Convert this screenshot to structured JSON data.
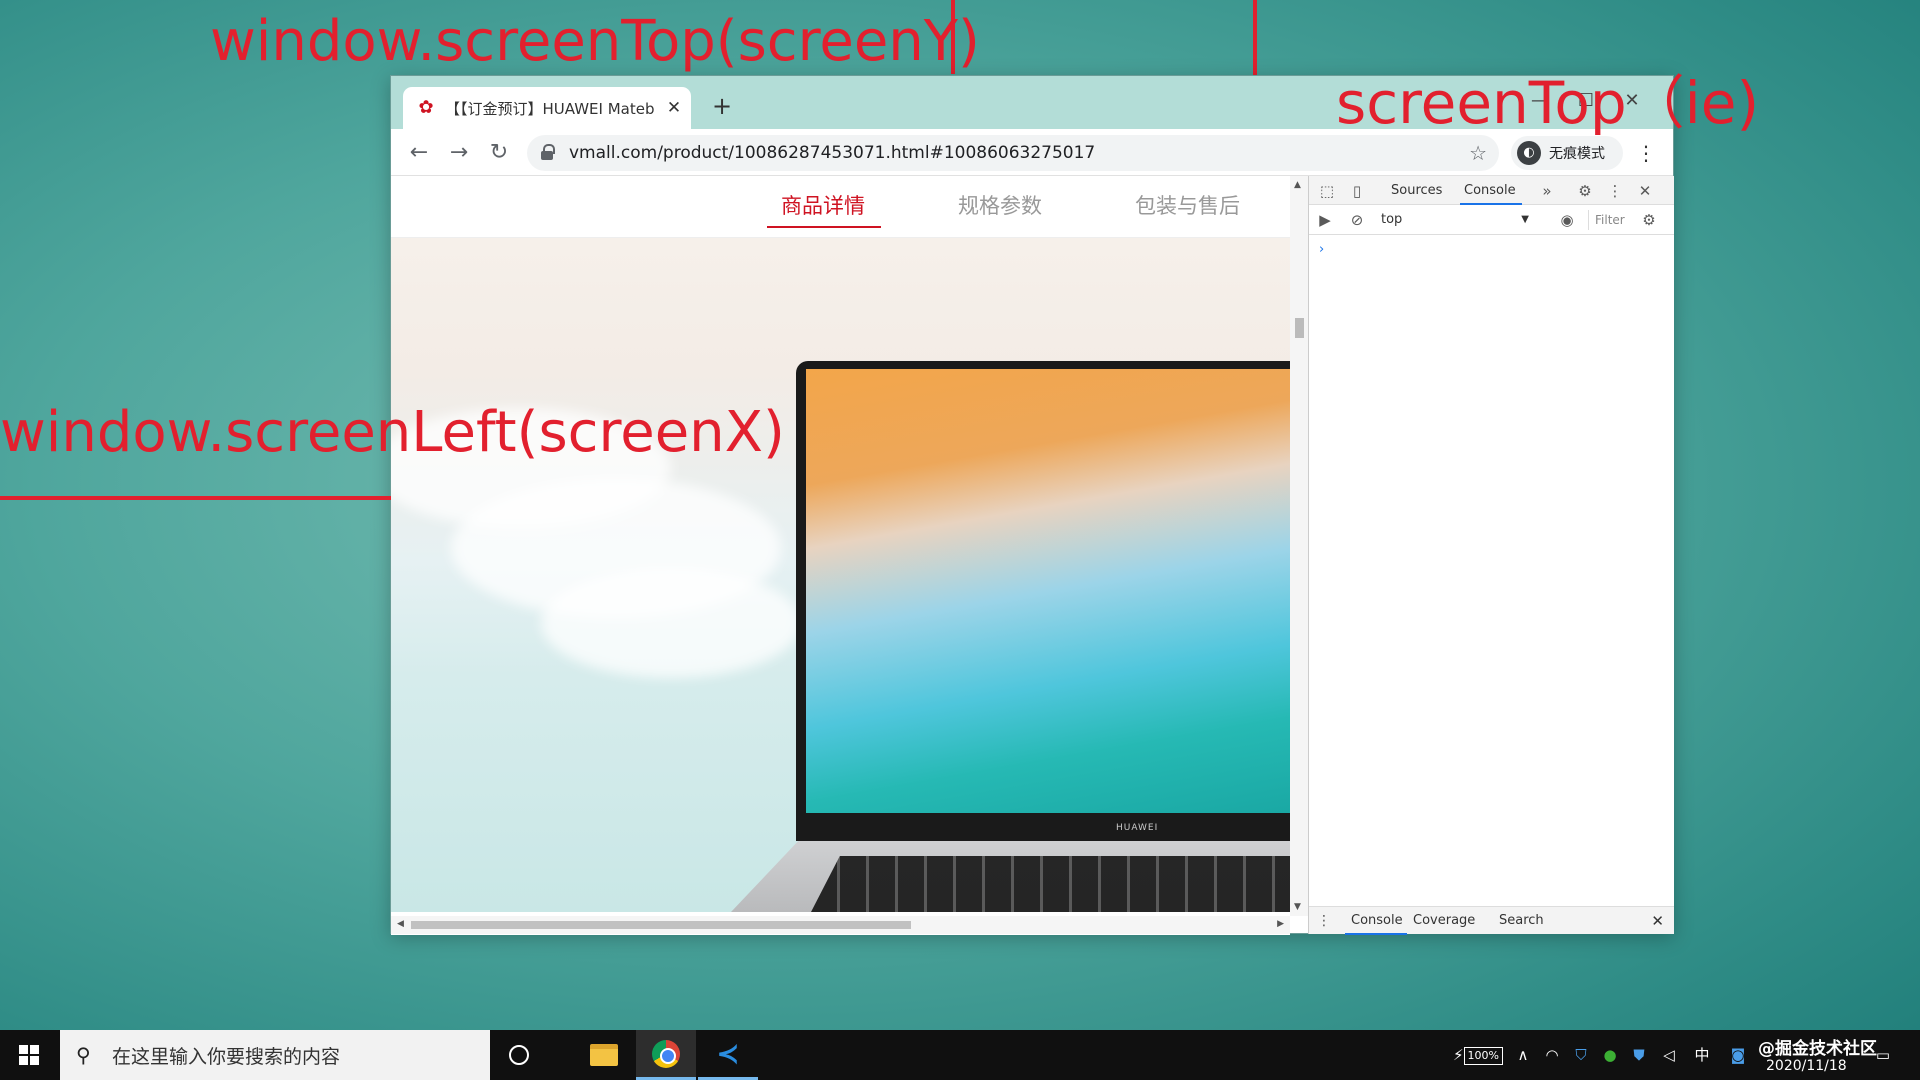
{
  "annotations": {
    "screen_top": "window.screenTop(screenY)",
    "screen_left": "window.screenLeft(screenX)",
    "screen_top_ie": "screenTop（ie)"
  },
  "browser": {
    "tab": {
      "title": "【【订金预订】HUAWEI Mateb",
      "favicon": "huawei-logo"
    },
    "nav": {
      "back_icon": "←",
      "forward_icon": "→",
      "reload_icon": "↻"
    },
    "address_bar": {
      "url": "vmall.com/product/10086287453071.html#10086063275017"
    },
    "incognito_label": "无痕模式",
    "window_controls": {
      "minimize": "—",
      "maximize": "☐",
      "close": "✕"
    }
  },
  "page": {
    "subnav": {
      "tabs": [
        "商品详情",
        "规格参数",
        "包装与售后"
      ],
      "active_index": 0
    },
    "laptop_brand": "HUAWEI"
  },
  "devtools": {
    "tabs": [
      "Sources",
      "Console"
    ],
    "active_tab": "Console",
    "context": "top",
    "filter_placeholder": "Filter",
    "prompt": "›",
    "drawer_tabs": [
      "Console",
      "Coverage",
      "Search"
    ],
    "active_drawer_tab": "Console"
  },
  "taskbar": {
    "search_placeholder": "在这里输入你要搜索的内容",
    "battery": "100%",
    "ime": "中",
    "watermark": "@掘金技术社区",
    "date": "2020/11/18"
  },
  "colors": {
    "annotation": "#e2202e",
    "active_subnav": "#cf1322",
    "devtools_accent": "#1a73e8"
  }
}
